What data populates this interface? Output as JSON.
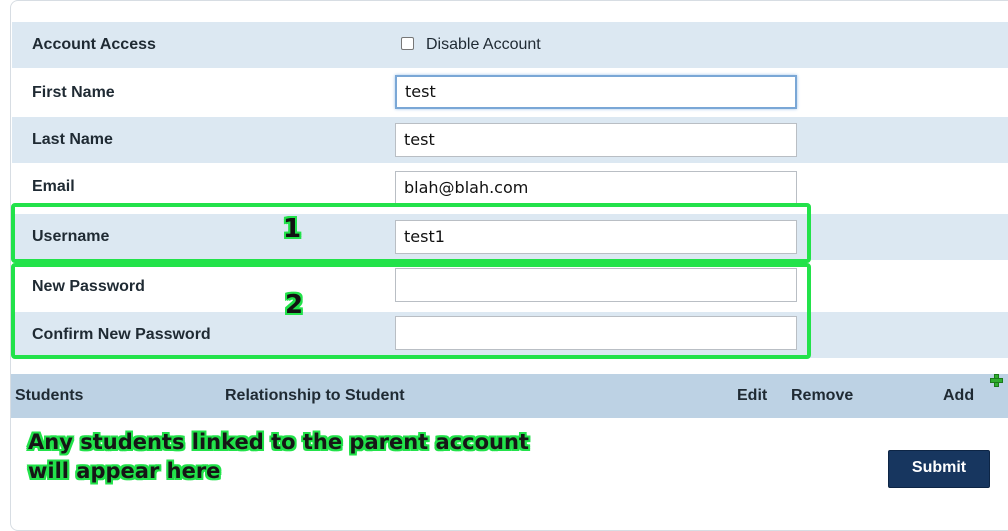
{
  "form": {
    "account_access_label": "Account Access",
    "disable_account_label": "Disable Account",
    "first_name_label": "First Name",
    "first_name_value": "test",
    "last_name_label": "Last Name",
    "last_name_value": "test",
    "email_label": "Email",
    "email_value": "blah@blah.com",
    "username_label": "Username",
    "username_value": "test1",
    "new_password_label": "New Password",
    "new_password_value": "",
    "confirm_password_label": "Confirm New Password",
    "confirm_password_value": ""
  },
  "annotations": {
    "marker_1": "1",
    "marker_2": "2",
    "students_note_line1": "Any students linked to the parent account",
    "students_note_line2": "will appear here",
    "highlight_color": "#22e24a"
  },
  "students_table": {
    "columns": [
      "Students",
      "Relationship to Student",
      "Edit",
      "Remove",
      "Add"
    ]
  },
  "actions": {
    "submit_label": "Submit"
  },
  "colors": {
    "row_alt": "#dce8f2",
    "table_header": "#bdd2e4",
    "submit_bg": "#17365f"
  },
  "icons": {
    "add": "plus-icon"
  }
}
